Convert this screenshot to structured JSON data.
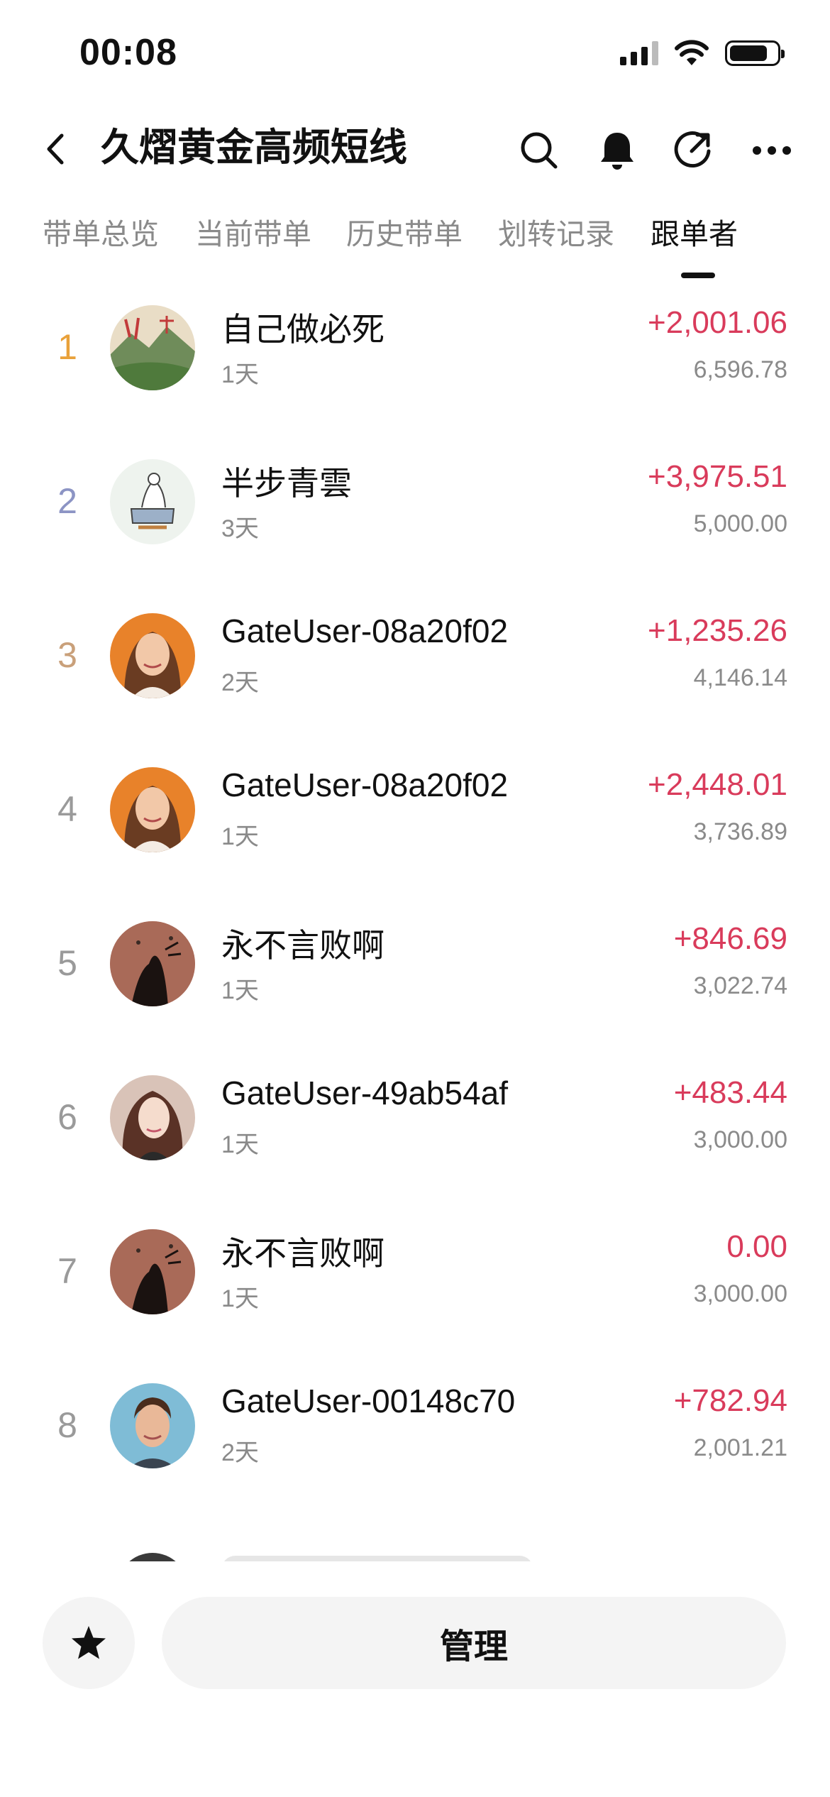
{
  "status_bar": {
    "time": "00:08"
  },
  "header": {
    "title": "久熠黄金高频短线"
  },
  "tabs": [
    {
      "label": "带单总览",
      "active": false
    },
    {
      "label": "当前带单",
      "active": false
    },
    {
      "label": "历史带单",
      "active": false
    },
    {
      "label": "划转记录",
      "active": false
    },
    {
      "label": "跟单者",
      "active": true
    }
  ],
  "colors": {
    "profit": "#d93b5b",
    "rank1": "#e9a13a",
    "rank2": "#8c94c4",
    "rank3": "#c9a07a",
    "rank_default": "#9a9a9a"
  },
  "followers": [
    {
      "rank": "1",
      "name": "自己做必死",
      "days": "1天",
      "pnl": "+2,001.06",
      "amount": "6,596.78",
      "avatar": "landscape-avatar"
    },
    {
      "rank": "2",
      "name": "半步青雲",
      "days": "3天",
      "pnl": "+3,975.51",
      "amount": "5,000.00",
      "avatar": "sketch-avatar"
    },
    {
      "rank": "3",
      "name": "GateUser-08a20f02",
      "days": "2天",
      "pnl": "+1,235.26",
      "amount": "4,146.14",
      "avatar": "woman-avatar"
    },
    {
      "rank": "4",
      "name": "GateUser-08a20f02",
      "days": "1天",
      "pnl": "+2,448.01",
      "amount": "3,736.89",
      "avatar": "woman-avatar"
    },
    {
      "rank": "5",
      "name": "永不言败啊",
      "days": "1天",
      "pnl": "+846.69",
      "amount": "3,022.74",
      "avatar": "silhouette-avatar"
    },
    {
      "rank": "6",
      "name": "GateUser-49ab54af",
      "days": "1天",
      "pnl": "+483.44",
      "amount": "3,000.00",
      "avatar": "girl-avatar"
    },
    {
      "rank": "7",
      "name": "永不言败啊",
      "days": "1天",
      "pnl": "0.00",
      "amount": "3,000.00",
      "avatar": "silhouette-avatar"
    },
    {
      "rank": "8",
      "name": "GateUser-00148c70",
      "days": "2天",
      "pnl": "+782.94",
      "amount": "2,001.21",
      "avatar": "man-avatar"
    }
  ],
  "bottom": {
    "manage_label": "管理"
  }
}
